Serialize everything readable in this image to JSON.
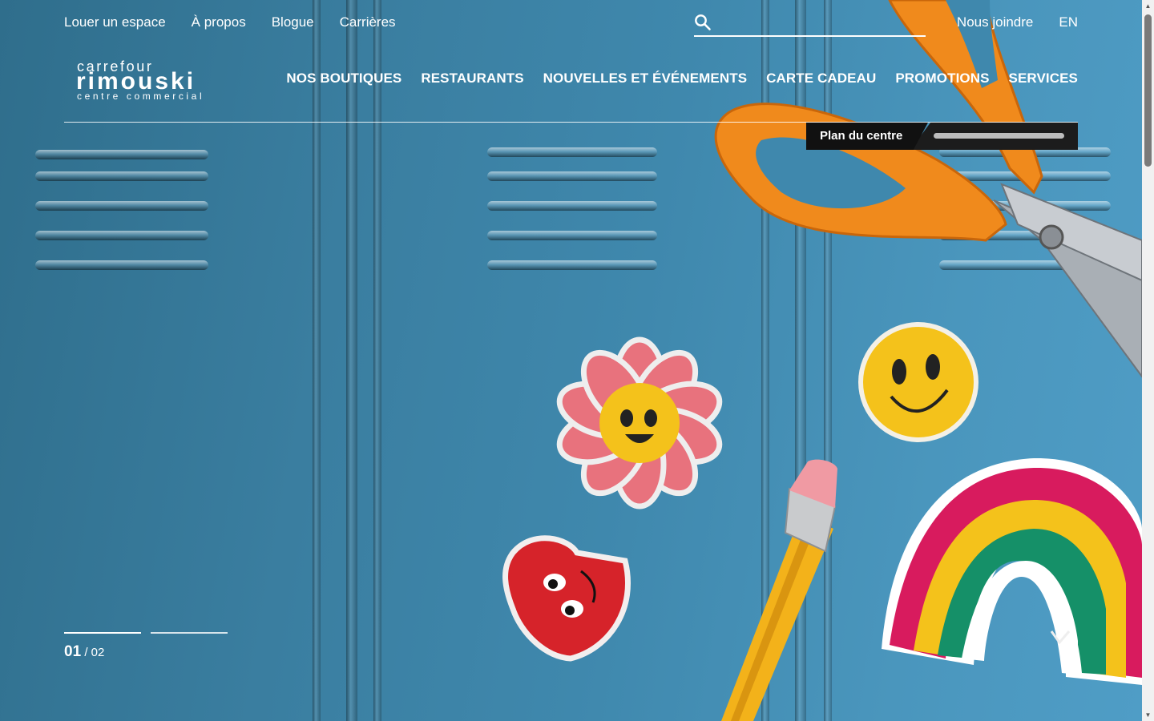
{
  "utility_nav": {
    "items": [
      {
        "label": "Louer un espace"
      },
      {
        "label": "À propos"
      },
      {
        "label": "Blogue"
      },
      {
        "label": "Carrières"
      }
    ]
  },
  "search": {
    "placeholder": "",
    "icon": "search-icon"
  },
  "right_nav": {
    "contact_label": "Nous joindre",
    "language_label": "EN"
  },
  "logo": {
    "line1": "carrefour",
    "line2": "rimouski",
    "line3": "centre commercial"
  },
  "main_nav": {
    "items": [
      {
        "label": "NOS BOUTIQUES"
      },
      {
        "label": "RESTAURANTS"
      },
      {
        "label": "NOUVELLES ET ÉVÉNEMENTS"
      },
      {
        "label": "CARTE CADEAU"
      },
      {
        "label": "PROMOTIONS"
      },
      {
        "label": "SERVICES"
      }
    ]
  },
  "map_tab": {
    "label": "Plan du centre"
  },
  "slider": {
    "current": "01",
    "separator": "/",
    "total": "02",
    "slide_count": 2,
    "active_index": 1
  },
  "colors": {
    "locker_blue": "#3f88ad",
    "text": "#ffffff",
    "tab_dark": "#111111",
    "scissors_orange": "#f08a1c",
    "flower_pink": "#e8727d",
    "smiley_yellow": "#f4c21b",
    "heart_red": "#d6232a",
    "rainbow_magenta": "#d81b5e",
    "rainbow_green": "#159068"
  }
}
